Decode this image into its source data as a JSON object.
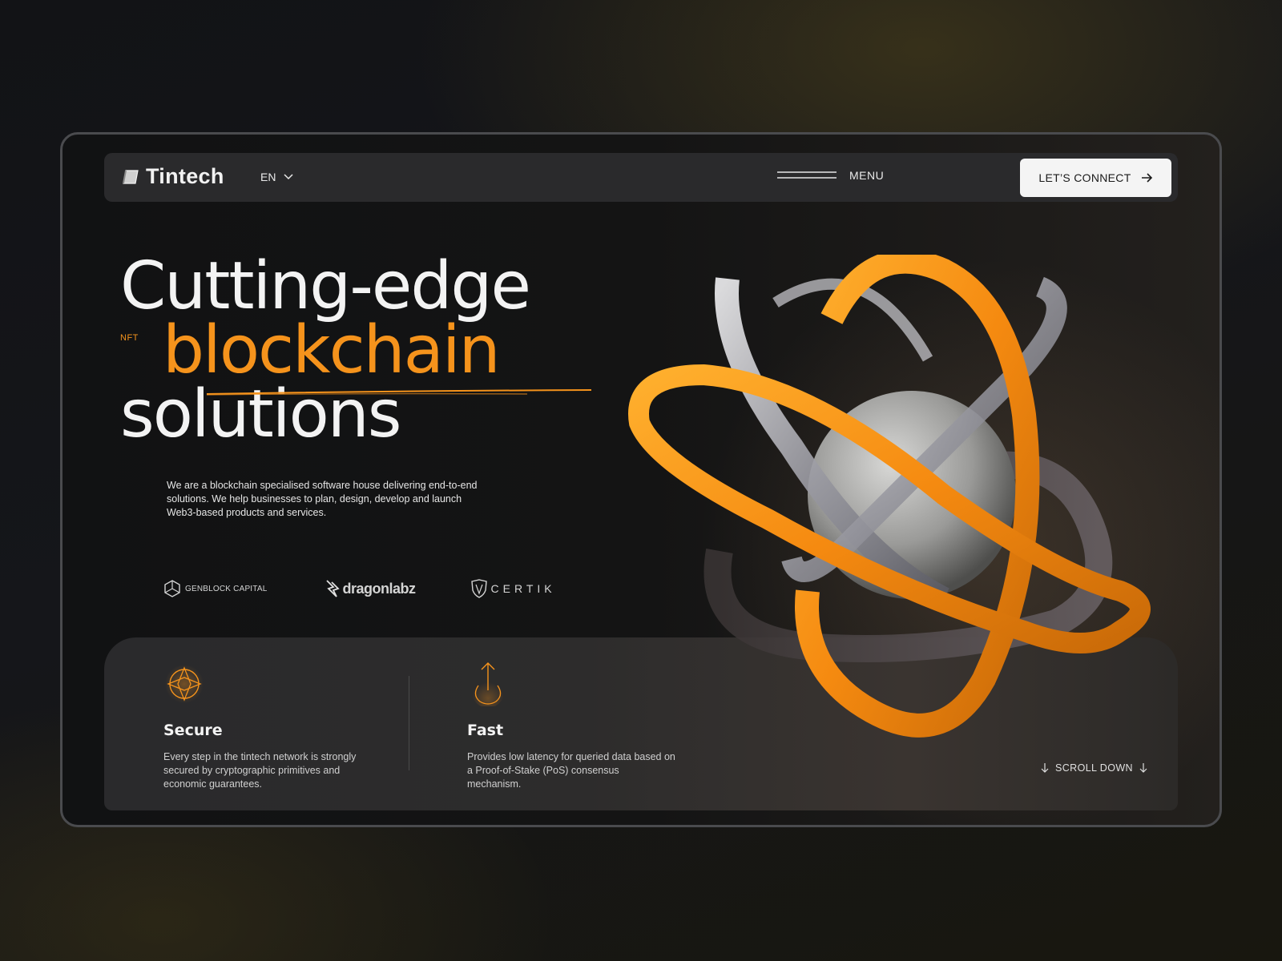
{
  "header": {
    "logo_text": "Tintech",
    "language": "EN",
    "menu_label": "MENU",
    "cta_label": "LET’S CONNECT"
  },
  "hero": {
    "headline_line1": "Cutting-edge",
    "headline_line2": "blockchain",
    "headline_line3": "solutions",
    "tag": "NFT",
    "description": "We are a blockchain specialised software house delivering end-to-end solutions. We help businesses to plan, design, develop and launch Web3-based products and services."
  },
  "partners": [
    {
      "name": "GENBLOCK CAPITAL",
      "icon": "genblock-icon"
    },
    {
      "name": "dragonlabz",
      "icon": "dragonlabz-icon"
    },
    {
      "name": "CERTIK",
      "icon": "certik-shield-icon"
    }
  ],
  "features": [
    {
      "title": "Secure",
      "description": "Every step in the tintech network is strongly secured by cryptographic primitives and economic guarantees.",
      "icon": "secure-icon"
    },
    {
      "title": "Fast",
      "description": "Provides low latency for queried data based on a Proof-of-Stake (PoS) consensus mechanism.",
      "icon": "fast-arrow-icon"
    }
  ],
  "scroll_label": "SCROLL DOWN",
  "colors": {
    "accent": "#f5931c",
    "background": "#131416",
    "panel": "#2a2a2c",
    "cta_bg": "#f4f4f4"
  }
}
